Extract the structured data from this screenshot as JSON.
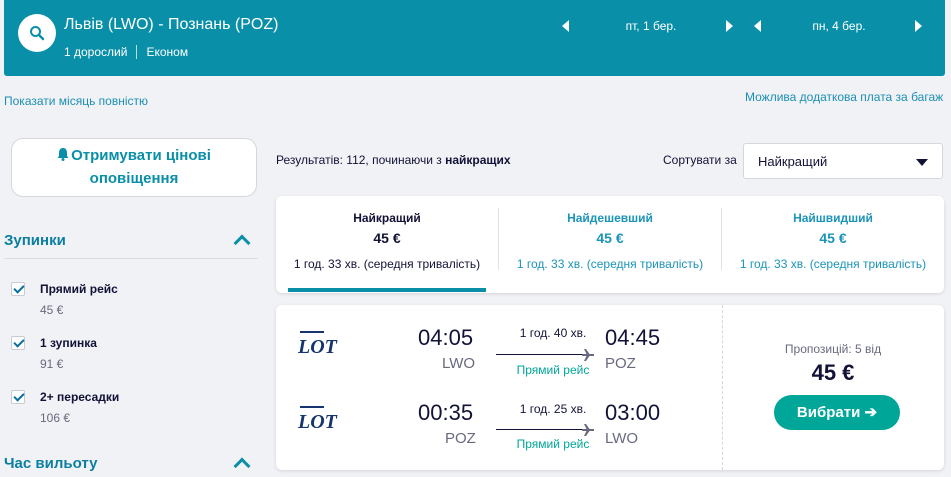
{
  "header": {
    "route": "Львів (LWO) - Познань (POZ)",
    "passengers": "1 дорослий",
    "cabin": "Економ",
    "depart_date": "пт, 1 бер.",
    "return_date": "пн, 4 бер."
  },
  "links": {
    "show_month": "Показати місяць повністю",
    "baggage": "Можлива додаткова плата за багаж"
  },
  "alerts": {
    "label_line1": "Отримувати цінові",
    "label_line2": "оповіщення"
  },
  "filters": {
    "stops_title": "Зупинки",
    "stops": [
      {
        "label": "Прямий рейс",
        "price": "45 €",
        "checked": true
      },
      {
        "label": "1 зупинка",
        "price": "91 €",
        "checked": true
      },
      {
        "label": "2+ пересадки",
        "price": "106 €",
        "checked": true
      }
    ],
    "departure_title": "Час вильоту"
  },
  "results": {
    "prefix": "Результатів: 112, починаючи з ",
    "bold": "найкращих",
    "sort_label": "Сортувати за",
    "sort_value": "Найкращий"
  },
  "tabs": [
    {
      "title": "Найкращий",
      "price": "45 €",
      "duration": "1 год. 33 хв. (середня тривалість)",
      "active": true
    },
    {
      "title": "Найдешевший",
      "price": "45 €",
      "duration": "1 год. 33 хв. (середня тривалість)",
      "active": false
    },
    {
      "title": "Найшвидший",
      "price": "45 €",
      "duration": "1 год. 33 хв. (середня тривалість)",
      "active": false
    }
  ],
  "card": {
    "legs": [
      {
        "airline": "LOT",
        "dep_time": "04:05",
        "dep_code": "LWO",
        "duration": "1 год. 40 хв.",
        "stops": "Прямий рейс",
        "arr_time": "04:45",
        "arr_code": "POZ"
      },
      {
        "airline": "LOT",
        "dep_time": "00:35",
        "dep_code": "POZ",
        "duration": "1 год. 25 хв.",
        "stops": "Прямий рейс",
        "arr_time": "03:00",
        "arr_code": "LWO"
      }
    ],
    "offers": "Пропозицій: 5 від",
    "price": "45 €",
    "select_label": "Вибрати ➔"
  },
  "colors": {
    "header": "#0a8fa8",
    "accent": "#00a698",
    "link": "#1b8fb3"
  }
}
